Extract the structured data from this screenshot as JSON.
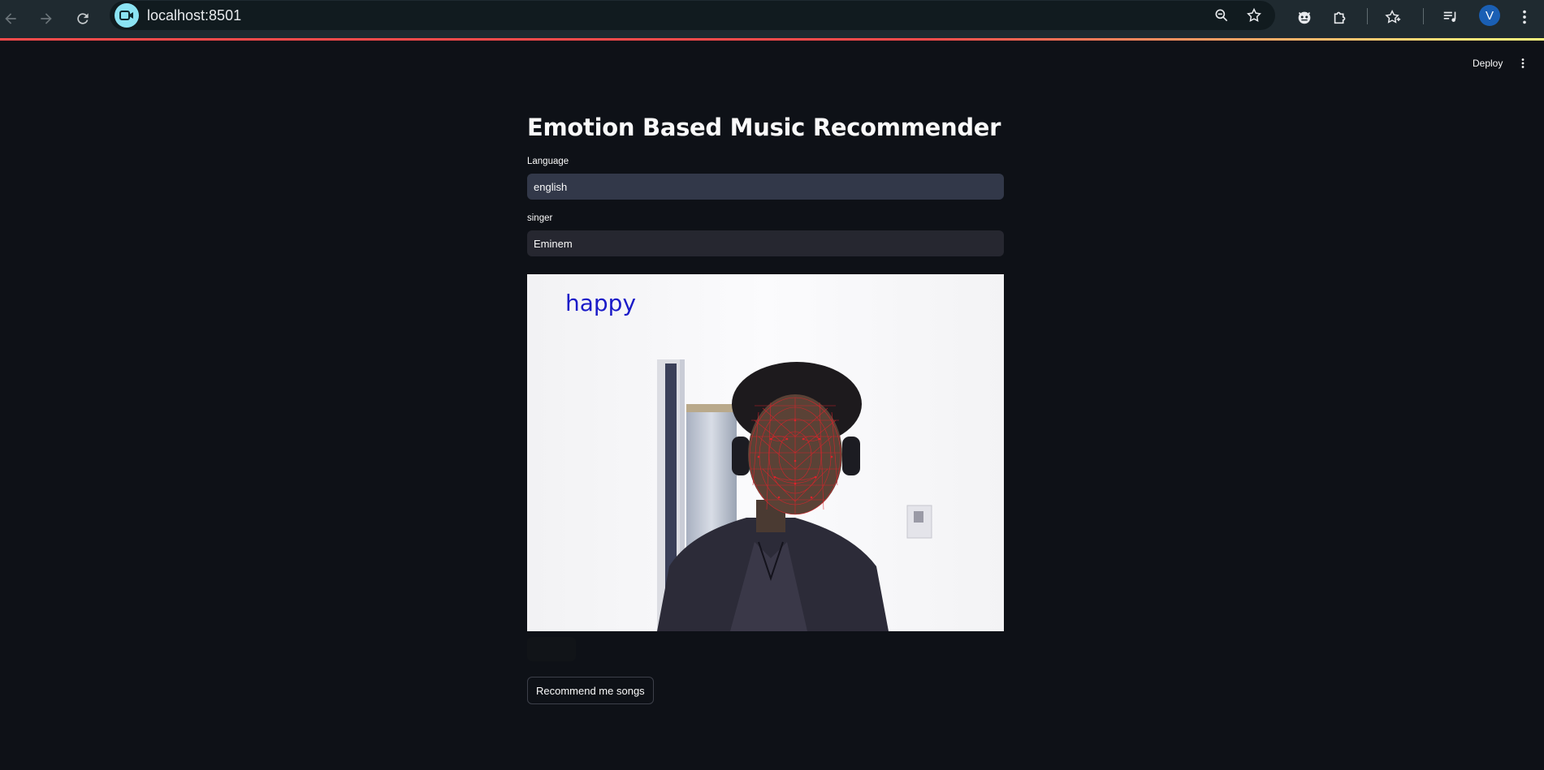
{
  "browser": {
    "url": "localhost:8501",
    "profile_initial": "V",
    "icons": [
      "back-arrow-icon",
      "forward-arrow-icon",
      "reload-icon",
      "video-camera-icon",
      "zoom-icon",
      "bookmark-star-icon",
      "extension-cat-icon",
      "puzzle-icon",
      "favorites-icon",
      "media-queue-icon",
      "more-vert-icon"
    ]
  },
  "header": {
    "deploy_label": "Deploy"
  },
  "app": {
    "title": "Emotion Based Music Recommender",
    "language_label": "Language",
    "language_value": "english",
    "singer_label": "singer",
    "singer_value": "Eminem",
    "detected_emotion": "happy",
    "recommend_label": "Recommend me songs"
  },
  "colors": {
    "background": "#0e1117",
    "accent": "#ff4b4b",
    "emotion_text": "#1b1bc8",
    "mesh": "#e8202a"
  }
}
